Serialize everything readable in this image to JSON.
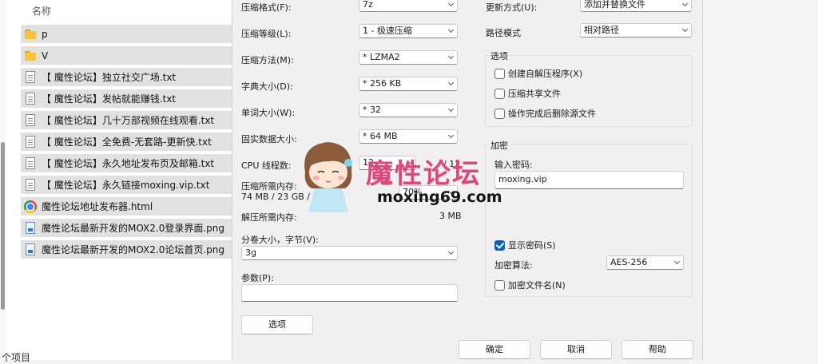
{
  "explorer": {
    "column_header": "名称",
    "files": [
      {
        "name": "p",
        "icon": "folder-icon"
      },
      {
        "name": "V",
        "icon": "folder-icon"
      },
      {
        "name": "【 魔性论坛】独立社交广场.txt",
        "icon": "text-file-icon"
      },
      {
        "name": "【 魔性论坛】发帖就能赚钱.txt",
        "icon": "text-file-icon"
      },
      {
        "name": "【 魔性论坛】几十万部视频在线观看.txt",
        "icon": "text-file-icon"
      },
      {
        "name": "【 魔性论坛】全免费-无套路-更新快.txt",
        "icon": "text-file-icon"
      },
      {
        "name": "【 魔性论坛】永久地址发布页及邮箱.txt",
        "icon": "text-file-icon"
      },
      {
        "name": "【 魔性论坛】永久链接moxing.vip.txt",
        "icon": "text-file-icon"
      },
      {
        "name": "魔性论坛地址发布器.html",
        "icon": "chrome-icon"
      },
      {
        "name": "魔性论坛最新开发的MOX2.0登录界面.png",
        "icon": "image-file-icon"
      },
      {
        "name": "魔性论坛最新开发的MOX2.0论坛首页.png",
        "icon": "image-file-icon"
      }
    ],
    "status": "个项目"
  },
  "dialog": {
    "format_label": "压缩格式(F):",
    "format_value": "7z",
    "level_label": "压缩等级(L):",
    "level_value": "1 - 极速压缩",
    "method_label": "压缩方法(M):",
    "method_value": "* LZMA2",
    "dict_label": "字典大小(D):",
    "dict_value": "* 256 KB",
    "word_label": "单词大小(W):",
    "word_value": "* 32",
    "solid_label": "固实数据大小:",
    "solid_value": "* 64 MB",
    "cpu_label": "CPU 线程数:",
    "cpu_value": "12",
    "cpu_max": "/ 12",
    "mem_label": "压缩所需内存:",
    "mem_value": "74 MB / 23 GB / 32",
    "mem_percent": "70%",
    "decomp_label": "解压所需内存:",
    "decomp_value": "3 MB",
    "split_label": "分卷大小，字节(V):",
    "split_value": "3g",
    "params_label": "参数(P):",
    "params_value": "",
    "options_button": "选项",
    "update_label": "更新方式(U):",
    "update_value": "添加并替换文件",
    "path_label": "路径模式",
    "path_value": "相对路径",
    "options_group": "选项",
    "opt_sfx": "创建自解压程序(X)",
    "opt_shared": "压缩共享文件",
    "opt_delete": "操作完成后删除源文件",
    "encrypt_group": "加密",
    "password_label": "输入密码:",
    "password_value": "moxing.vip",
    "show_password": "显示密码(S)",
    "encrypt_method_label": "加密算法:",
    "encrypt_method_value": "AES-256",
    "encrypt_names": "加密文件名(N)",
    "ok_button": "确定",
    "cancel_button": "取消",
    "help_button": "帮助"
  },
  "watermark": {
    "title": "魔性论坛",
    "url": "moxing69.com"
  },
  "colors": {
    "accent": "#0067c0",
    "watermark": "#e0457b"
  }
}
